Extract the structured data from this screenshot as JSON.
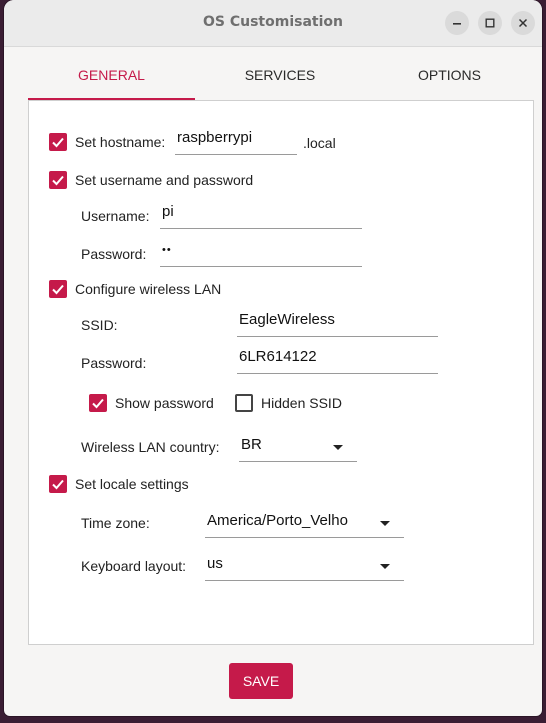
{
  "window": {
    "title": "OS Customisation"
  },
  "tabs": [
    {
      "label": "GENERAL",
      "active": true
    },
    {
      "label": "SERVICES",
      "active": false
    },
    {
      "label": "OPTIONS",
      "active": false
    }
  ],
  "general": {
    "hostname": {
      "label": "Set hostname:",
      "checked": true,
      "value": "raspberrypi",
      "suffix": ".local"
    },
    "user": {
      "label": "Set username and password",
      "checked": true,
      "username_label": "Username:",
      "username_value": "pi",
      "password_label": "Password:",
      "password_value": "••"
    },
    "wifi": {
      "label": "Configure wireless LAN",
      "checked": true,
      "ssid_label": "SSID:",
      "ssid_value": "EagleWireless",
      "password_label": "Password:",
      "password_value": "6LR614122",
      "show_password_label": "Show password",
      "show_password_checked": true,
      "hidden_ssid_label": "Hidden SSID",
      "hidden_ssid_checked": false,
      "country_label": "Wireless LAN country:",
      "country_value": "BR"
    },
    "locale": {
      "label": "Set locale settings",
      "checked": true,
      "timezone_label": "Time zone:",
      "timezone_value": "America/Porto_Velho",
      "keyboard_label": "Keyboard layout:",
      "keyboard_value": "us"
    }
  },
  "save_label": "SAVE",
  "colors": {
    "accent": "#c51a4a",
    "titlebar": "#ebebeb",
    "panel": "#ffffff"
  }
}
